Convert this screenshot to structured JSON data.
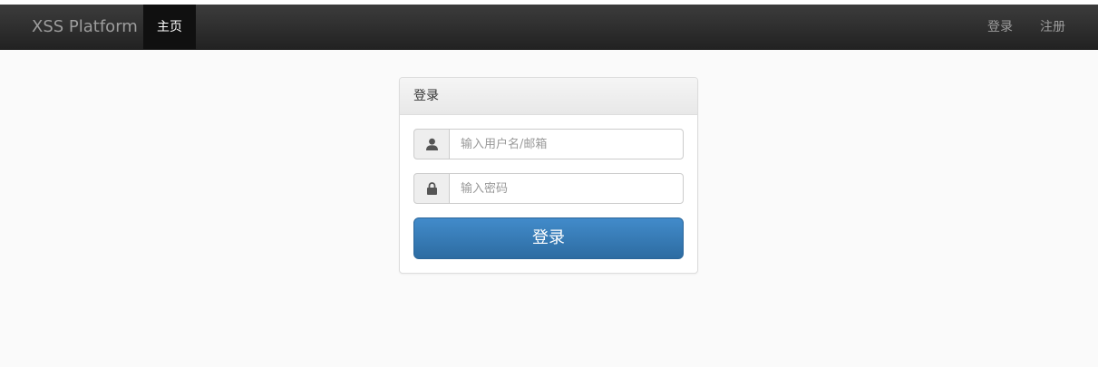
{
  "navbar": {
    "brand": "XSS Platform",
    "home_label": "主页",
    "login_label": "登录",
    "register_label": "注册"
  },
  "login_panel": {
    "title": "登录",
    "username_placeholder": "输入用户名/邮箱",
    "password_placeholder": "输入密码",
    "submit_label": "登录",
    "username_icon": "user-icon",
    "password_icon": "lock-icon"
  },
  "colors": {
    "navbar_bg": "#222222",
    "active_nav_bg": "#101010",
    "button_primary": "#428bca",
    "page_bg": "#fafafa"
  }
}
